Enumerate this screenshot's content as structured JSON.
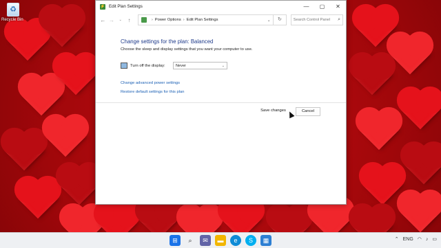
{
  "desktop": {
    "recycle_bin_label": "Recycle Bin"
  },
  "window": {
    "title": "Edit Plan Settings",
    "controls": {
      "minimize": "—",
      "maximize": "▢",
      "close": "✕"
    }
  },
  "address": {
    "crumbs": [
      "Power Options",
      "Edit Plan Settings"
    ],
    "separator": "›"
  },
  "search": {
    "placeholder": "Search Control Panel"
  },
  "plan": {
    "heading": "Change settings for the plan: Balanced",
    "description": "Choose the sleep and display settings that you want your computer to use.",
    "display_label": "Turn off the display:",
    "display_value": "Never",
    "advanced_link": "Change advanced power settings",
    "restore_link": "Restore default settings for this plan",
    "save_label": "Save changes",
    "cancel_label": "Cancel"
  },
  "taskbar": {
    "apps": [
      {
        "icon": "windows-start-icon",
        "color": "#1a73e8"
      },
      {
        "icon": "search-icon",
        "color": "#333333"
      },
      {
        "icon": "chat-icon",
        "color": "#6264a7"
      },
      {
        "icon": "file-explorer-icon",
        "color": "#f2b600"
      },
      {
        "icon": "edge-icon",
        "color": "#0f8bd6"
      },
      {
        "icon": "skype-icon",
        "color": "#00aff0"
      },
      {
        "icon": "control-panel-icon",
        "color": "#2d7fd3"
      }
    ],
    "language": "ENG"
  },
  "colors": {
    "accent_text": "#1e3a8a",
    "link": "#1a5fb4"
  }
}
